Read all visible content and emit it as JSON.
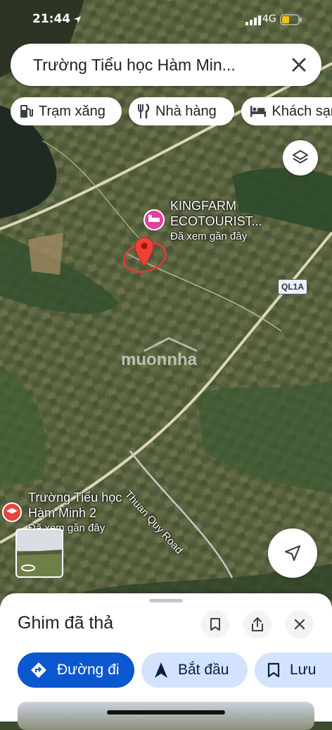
{
  "status_bar": {
    "time": "21:44",
    "network": "4G"
  },
  "search": {
    "query": "Trường Tiểu học Hàm Min..."
  },
  "chips": [
    {
      "label": "Trạm xăng",
      "icon": "gas-station-icon"
    },
    {
      "label": "Nhà hàng",
      "icon": "restaurant-icon"
    },
    {
      "label": "Khách sạn",
      "icon": "hotel-icon"
    }
  ],
  "map": {
    "place_name_line1": "KINGFARM",
    "place_name_line2": "ECOTOURIST...",
    "place_note": "Đã xem gần đây",
    "road_shield": "QL1A",
    "road_name": "Thuan Quy Road",
    "watermark": "muonnha",
    "school_line1": "Trường Tiểu học",
    "school_line2": "Hàm Minh 2",
    "school_note": "Đã xem gần đây",
    "accent_color": "#1a73e8",
    "pin_color": "#ea4335",
    "hotel_marker_color": "#e040a0"
  },
  "sheet": {
    "title": "Ghim đã thả",
    "directions_label": "Đường đi",
    "start_label": "Bắt đầu",
    "save_label": "Lưu",
    "directions_color": "#0b57d0"
  }
}
